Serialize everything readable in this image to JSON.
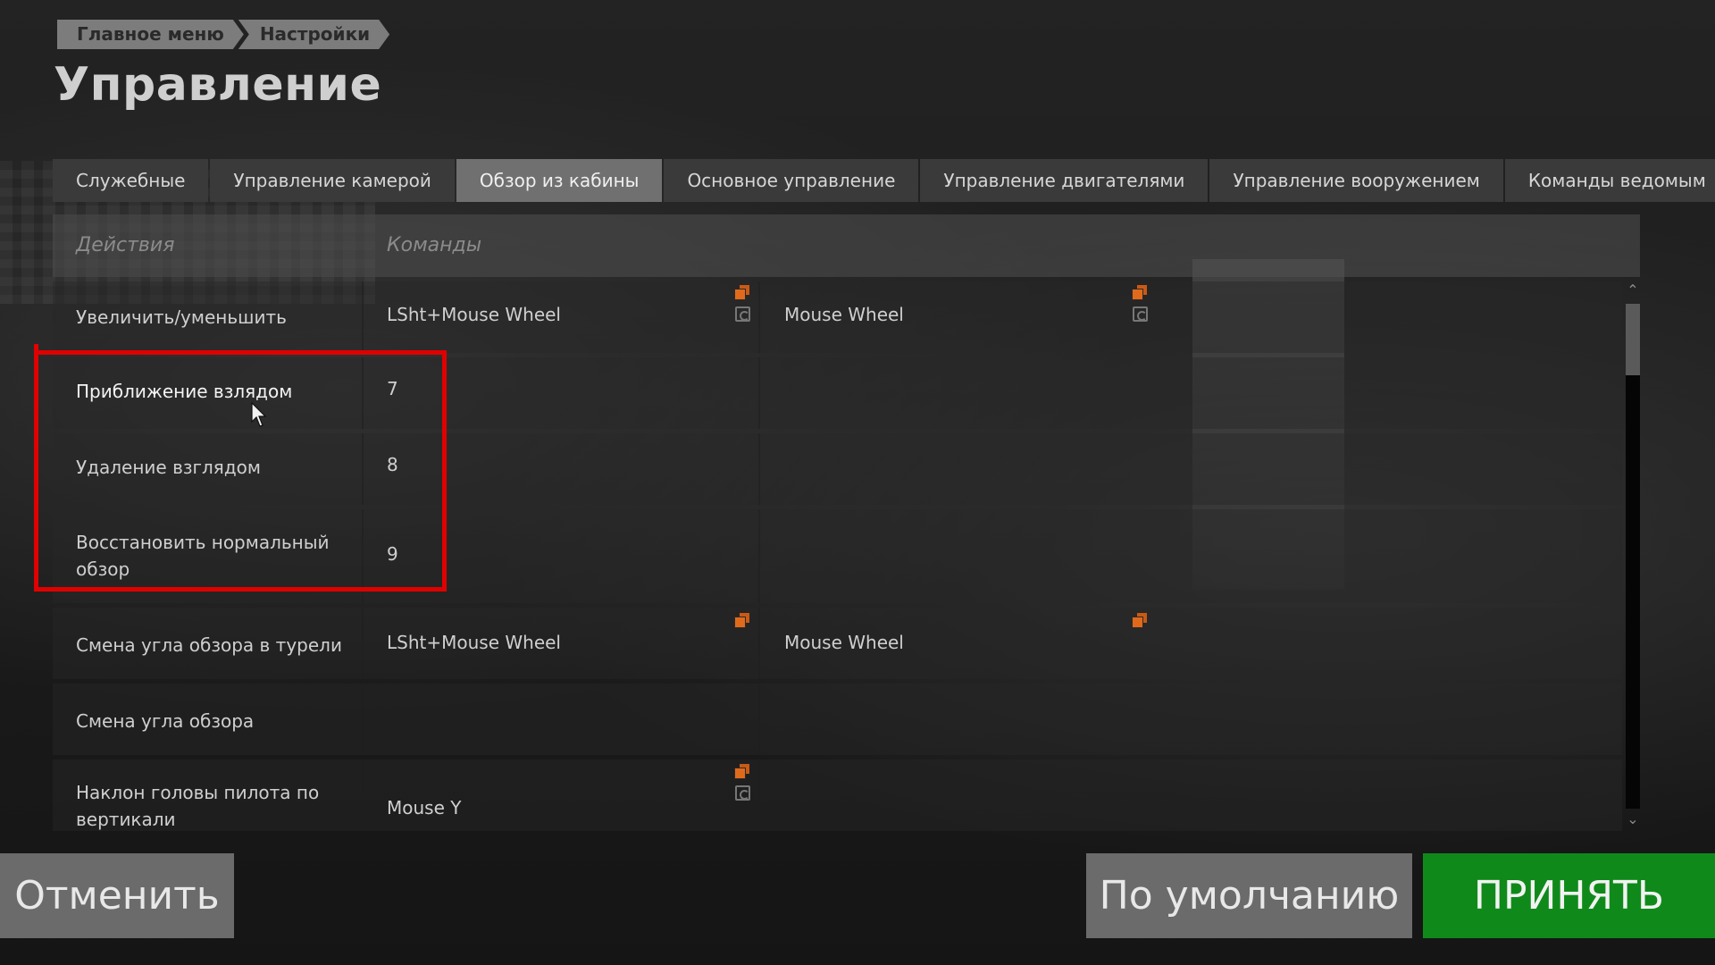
{
  "breadcrumb": [
    "Главное меню",
    "Настройки"
  ],
  "title": "Управление",
  "tabs": [
    {
      "label": "Служебные",
      "active": false
    },
    {
      "label": "Управление камерой",
      "active": false
    },
    {
      "label": "Обзор из кабины",
      "active": true
    },
    {
      "label": "Основное управление",
      "active": false
    },
    {
      "label": "Управление двигателями",
      "active": false
    },
    {
      "label": "Управление вооружением",
      "active": false
    },
    {
      "label": "Команды ведомым",
      "active": false
    }
  ],
  "table": {
    "header_actions": "Действия",
    "header_commands": "Команды",
    "rows": [
      {
        "action": "Увеличить/уменьшить",
        "cmd1": "LSht+Mouse Wheel",
        "cmd2": "Mouse Wheel"
      },
      {
        "action": "Приближение взлядом",
        "cmd1": "7",
        "cmd2": ""
      },
      {
        "action": "Удаление взглядом",
        "cmd1": "8",
        "cmd2": ""
      },
      {
        "action": "Восстановить нормальный обзор",
        "cmd1": "9",
        "cmd2": ""
      },
      {
        "action": "Смена угла обзора в турели",
        "cmd1": "LSht+Mouse Wheel",
        "cmd2": "Mouse Wheel"
      },
      {
        "action": "Смена угла обзора",
        "cmd1": "",
        "cmd2": ""
      },
      {
        "action": "Наклон головы пилота по вертикали",
        "cmd1": "Mouse Y",
        "cmd2": ""
      }
    ]
  },
  "buttons": {
    "cancel": "Отменить",
    "default": "По умолчанию",
    "accept": "ПРИНЯТЬ"
  },
  "colors": {
    "accent_orange": "#e06a1c",
    "accept_green": "#0f8a1a",
    "annotation_red": "#e00000"
  },
  "icons": {
    "copy": "copy-binding-icon",
    "reset": "reset-binding-icon"
  }
}
